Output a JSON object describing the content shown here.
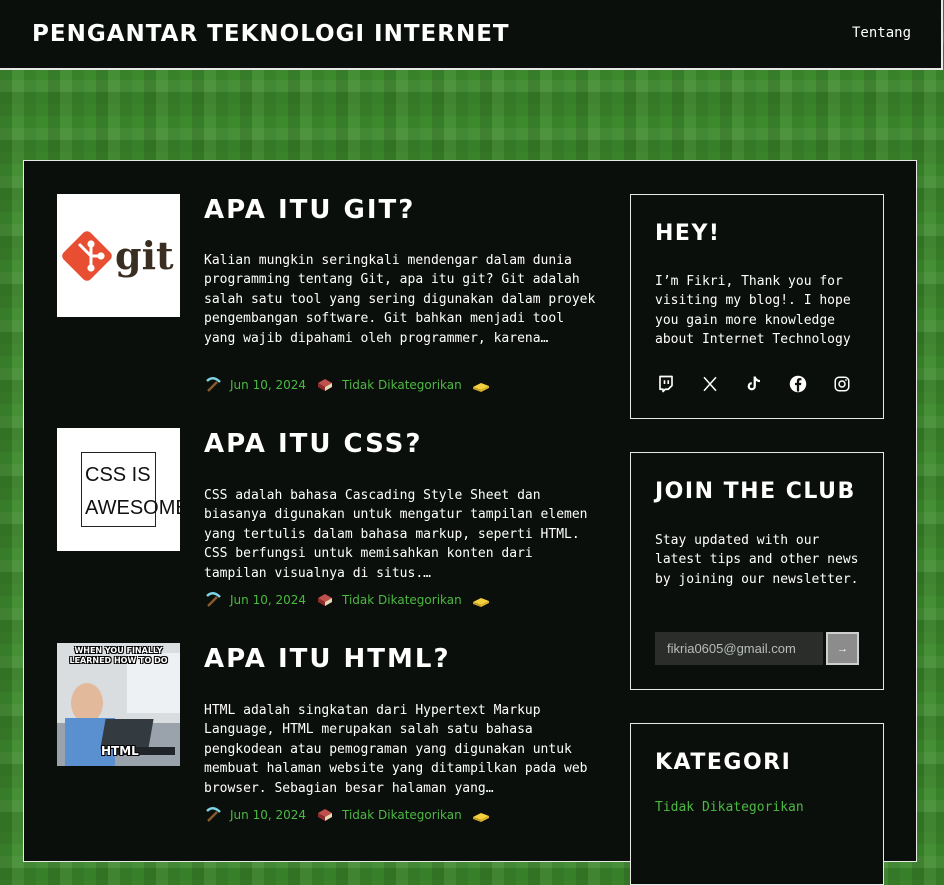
{
  "site": {
    "title": "PENGANTAR TEKNOLOGI INTERNET",
    "nav": {
      "about": "Tentang"
    }
  },
  "posts": [
    {
      "title": "APA ITU GIT?",
      "excerpt": "Kalian mungkin seringkali mendengar dalam dunia programming tentang Git, apa itu git? Git adalah salah satu tool yang sering digunakan dalam proyek pengembangan software. Git bahkan menjadi tool yang wajib dipahami oleh programmer, karena…",
      "date": "Jun 10, 2024",
      "category": "Tidak Dikategorikan",
      "thumb_text": "git"
    },
    {
      "title": "APA ITU CSS?",
      "excerpt": "CSS adalah bahasa Cascading Style Sheet dan biasanya digunakan untuk mengatur tampilan elemen yang tertulis dalam bahasa markup, seperti HTML. CSS berfungsi untuk memisahkan konten dari tampilan visualnya di situs.…",
      "date": "Jun 10, 2024",
      "category": "Tidak Dikategorikan",
      "thumb_line1": "CSS IS",
      "thumb_line2": "AWESOME"
    },
    {
      "title": "APA ITU HTML?",
      "excerpt": "HTML adalah singkatan dari Hypertext Markup Language, HTML merupakan salah satu bahasa pengkodean atau pemograman yang digunakan untuk membuat halaman website yang ditampilkan pada web browser. Sebagian besar halaman yang…",
      "date": "Jun 10, 2024",
      "category": "Tidak Dikategorikan",
      "thumb_caption_top": "WHEN YOU FINALLY LEARNED HOW TO DO",
      "thumb_caption_bottom": "HTML"
    }
  ],
  "sidebar": {
    "hey": {
      "title": "HEY!",
      "text": "I’m Fikri, Thank you for visiting my blog!. I hope you gain more knowledge about Internet Technology",
      "social_icons": [
        "twitch-icon",
        "x-icon",
        "tiktok-icon",
        "facebook-icon",
        "instagram-icon"
      ]
    },
    "club": {
      "title": "JOIN THE CLUB",
      "text": "Stay updated with our latest tips and other news by joining our newsletter.",
      "email_value": "fikria0605@gmail.com",
      "submit_label": "→"
    },
    "categories": {
      "title": "KATEGORI",
      "items": [
        "Tidak Dikategorikan"
      ]
    }
  },
  "colors": {
    "accent_green": "#4cb842",
    "panel_bg": "#0b0f0b",
    "border": "#e8e8e8",
    "grass": "#3d8a2c"
  }
}
